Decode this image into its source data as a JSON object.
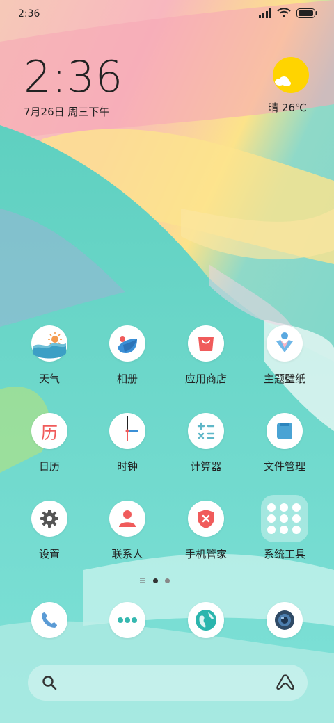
{
  "status_bar": {
    "time": "2:36"
  },
  "clock": {
    "time": "2:36",
    "date": "7月26日 周三下午"
  },
  "weather": {
    "text": "晴 26℃"
  },
  "apps": [
    {
      "label": "天气",
      "icon": "weather-icon"
    },
    {
      "label": "相册",
      "icon": "gallery-icon"
    },
    {
      "label": "应用商店",
      "icon": "app-store-icon"
    },
    {
      "label": "主题壁纸",
      "icon": "theme-icon"
    },
    {
      "label": "日历",
      "icon": "calendar-icon",
      "glyph": "历"
    },
    {
      "label": "时钟",
      "icon": "clock-icon"
    },
    {
      "label": "计算器",
      "icon": "calculator-icon"
    },
    {
      "label": "文件管理",
      "icon": "file-manager-icon"
    },
    {
      "label": "设置",
      "icon": "settings-icon"
    },
    {
      "label": "联系人",
      "icon": "contacts-icon"
    },
    {
      "label": "手机管家",
      "icon": "security-icon"
    },
    {
      "label": "系统工具",
      "icon": "folder-icon"
    }
  ],
  "page_indicator": {
    "pages": 2,
    "current": 1
  },
  "dock": [
    "phone-icon",
    "messages-icon",
    "browser-icon",
    "camera-icon"
  ],
  "colors": {
    "accent_red": "#f05b5b",
    "accent_blue": "#3a8fd6",
    "teal": "#35b8b0"
  }
}
